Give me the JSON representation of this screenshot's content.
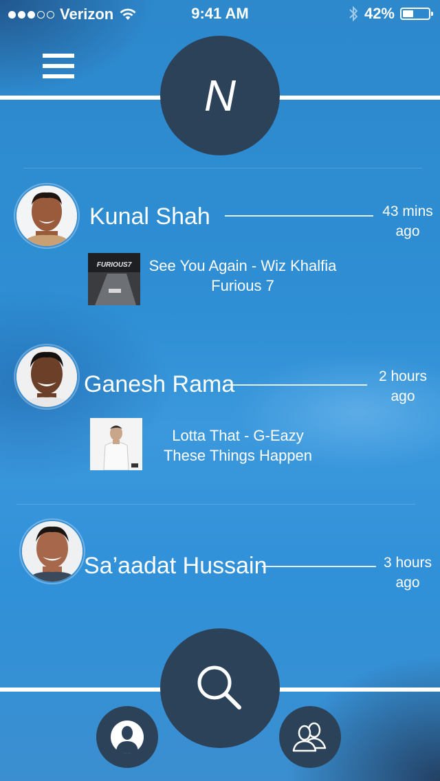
{
  "status_bar": {
    "signal_dots": [
      true,
      true,
      true,
      false,
      false
    ],
    "carrier": "Verizon",
    "time": "9:41 AM",
    "battery_text": "42%",
    "battery_level": 0.42,
    "icons": [
      "wifi-icon",
      "bluetooth-icon",
      "battery-icon"
    ]
  },
  "header": {
    "menu_icon": "hamburger-menu-icon",
    "logo_letter": "N"
  },
  "feed": [
    {
      "name": "Kunal Shah",
      "time_line1": "43 mins",
      "time_line2": "ago",
      "song_line1": "See You Again - Wiz Khalfia",
      "song_line2": "Furious 7",
      "album_text": "FURIOUS7"
    },
    {
      "name": "Ganesh Rama",
      "time_line1": "2 hours",
      "time_line2": "ago",
      "song_line1": "Lotta That - G-Eazy",
      "song_line2": "These Things Happen"
    },
    {
      "name": "Sa’aadat Hussain",
      "time_line1": "3 hours",
      "time_line2": "ago"
    }
  ],
  "bottom_bar": {
    "search_icon": "search-icon",
    "profile_icon": "profile-icon",
    "friends_icon": "friends-icon"
  },
  "colors": {
    "background": "#3090d8",
    "circle": "#2c4258",
    "text": "#ffffff"
  }
}
